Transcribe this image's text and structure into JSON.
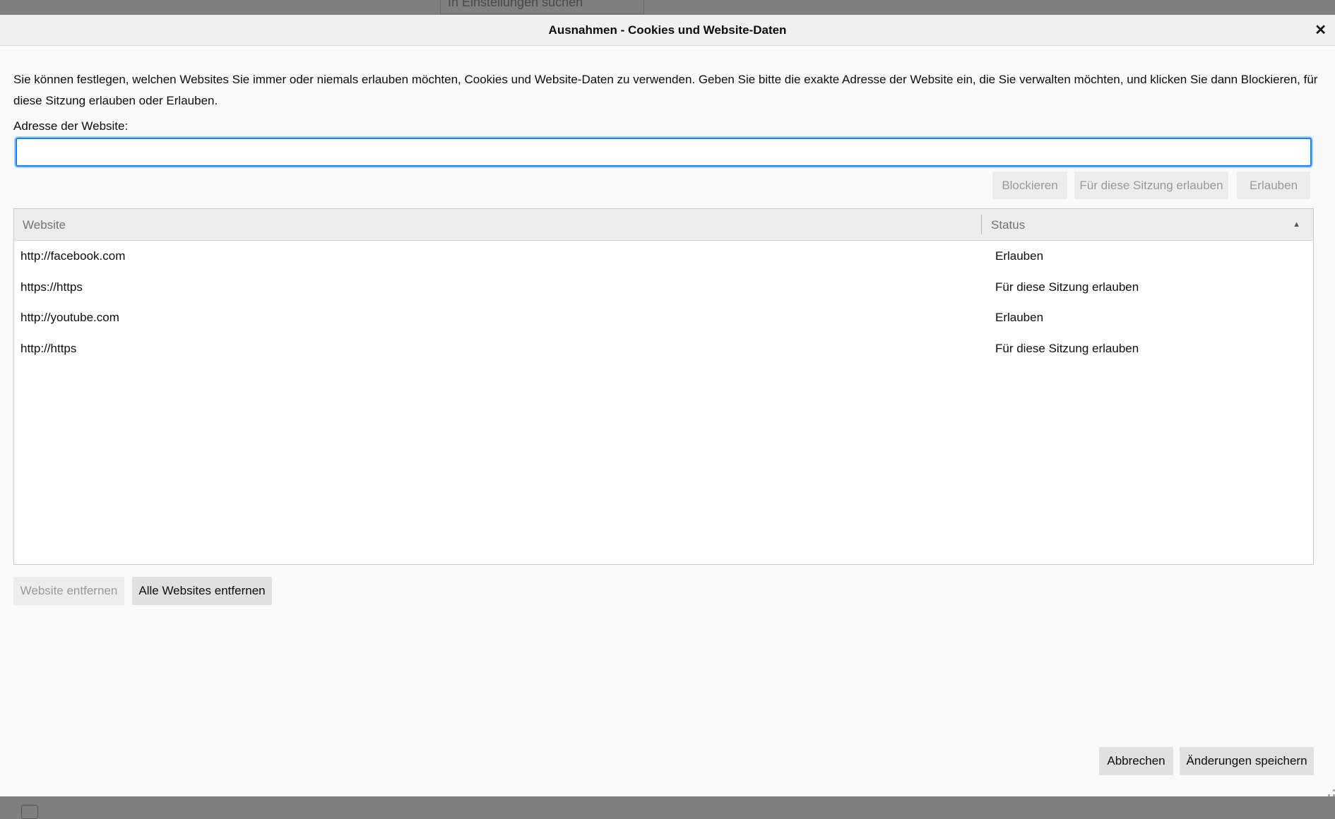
{
  "background": {
    "search_placeholder": "In Einstellungen suchen"
  },
  "dialog": {
    "title": "Ausnahmen - Cookies und Website-Daten",
    "close_icon": "close-icon",
    "description": "Sie können festlegen, welchen Websites Sie immer oder niemals erlauben möchten, Cookies und Website-Daten zu verwenden. Geben Sie bitte die exakte Adresse der Website ein, die Sie verwalten möchten, und klicken Sie dann Blockieren, für diese Sitzung erlauben oder Erlauben.",
    "address_label": "Adresse der Website:",
    "address_value": "",
    "buttons": {
      "block": "Blockieren",
      "session": "Für diese Sitzung erlauben",
      "allow": "Erlauben"
    },
    "table": {
      "columns": [
        "Website",
        "Status"
      ],
      "sort_indicator": "sort-ascending-icon",
      "rows": [
        {
          "website": "http://facebook.com",
          "status": "Erlauben"
        },
        {
          "website": "https://https",
          "status": "Für diese Sitzung erlauben"
        },
        {
          "website": "http://youtube.com",
          "status": "Erlauben"
        },
        {
          "website": "http://https",
          "status": "Für diese Sitzung erlauben"
        }
      ]
    },
    "remove_site": "Website entfernen",
    "remove_all": "Alle Websites entfernen",
    "cancel": "Abbrechen",
    "save": "Änderungen speichern"
  },
  "colors": {
    "focus": "#0a84ff",
    "dialog_bg": "#f9f9f9",
    "overlay": "#7f7f7f"
  }
}
